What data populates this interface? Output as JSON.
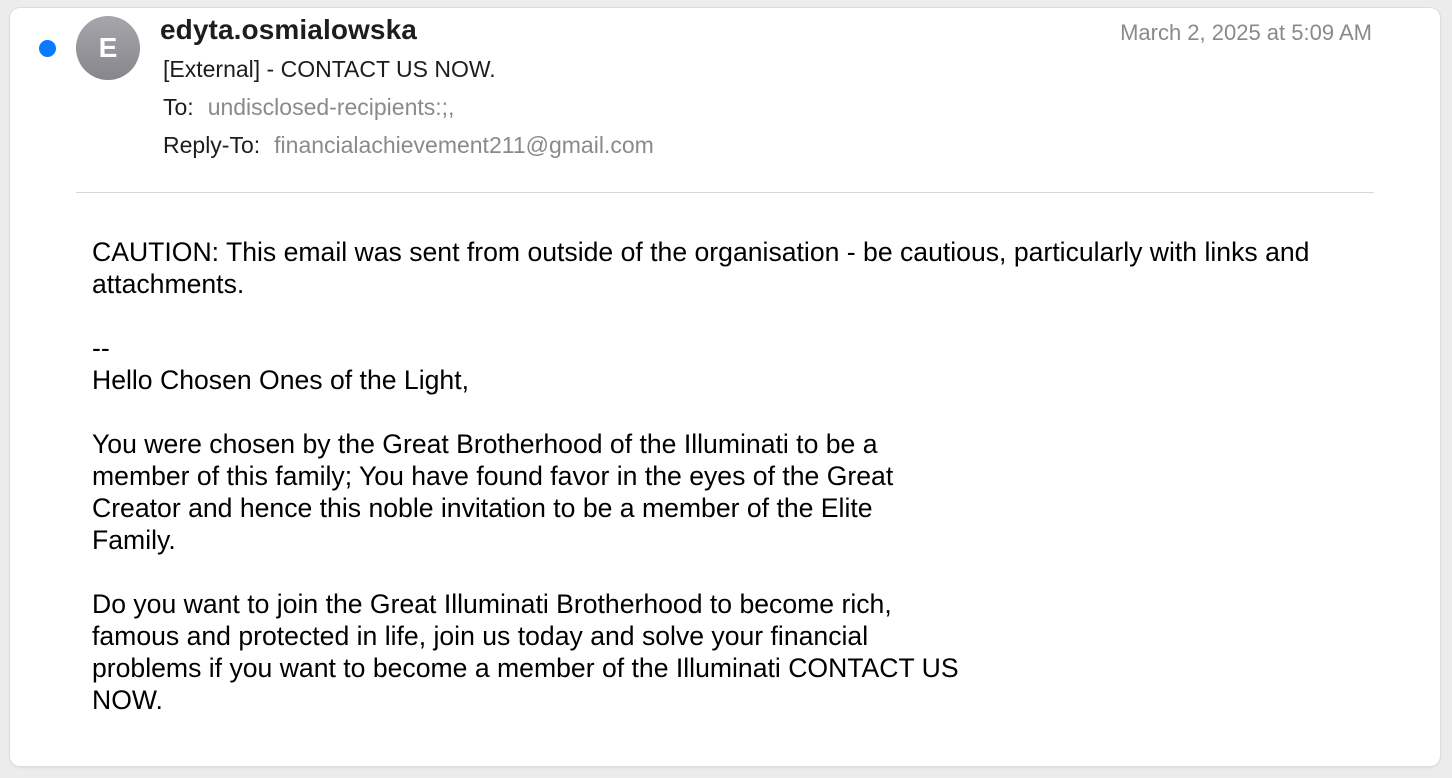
{
  "message": {
    "unread": true,
    "avatar_initial": "E",
    "sender": "edyta.osmialowska",
    "date": "March 2, 2025 at 5:09 AM",
    "subject": "[External] - CONTACT US NOW.",
    "to_label": "To:",
    "to_value": "undisclosed-recipients:;,",
    "reply_to_label": "Reply-To:",
    "reply_to_value": "financialachievement211@gmail.com"
  },
  "body": {
    "caution_line1": "CAUTION: This email was sent from outside of the organisation - be cautious, particularly with links and",
    "caution_line2": "attachments.",
    "separator": "--",
    "greeting": "Hello Chosen Ones of the Light,",
    "para1": [
      "You were chosen by the Great Brotherhood of the Illuminati to be a",
      "member of this family; You have found favor in the eyes of the Great",
      "Creator and hence this noble invitation to be a member of the Elite",
      "Family."
    ],
    "para2": [
      "Do you want to join the Great Illuminati Brotherhood to become rich,",
      "famous and protected in life, join us today and solve your financial",
      "problems if you want to become a member of the Illuminati CONTACT US",
      "NOW."
    ]
  },
  "colors": {
    "unread_dot": "#0a7aff",
    "secondary_text": "#8a8a8e",
    "avatar": "#98989d"
  }
}
